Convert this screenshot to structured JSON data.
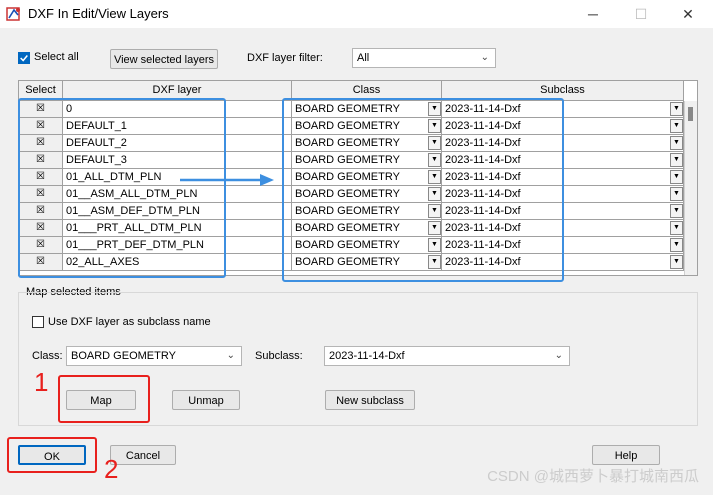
{
  "window": {
    "title": "DXF In Edit/View Layers",
    "minimize": "─",
    "maximize": "☐",
    "close": "✕"
  },
  "toolbar": {
    "select_all_label": "Select all",
    "view_selected_label": "View selected layers",
    "filter_label": "DXF layer filter:",
    "filter_value": "All"
  },
  "grid": {
    "headers": [
      "Select",
      "DXF layer",
      "Class",
      "Subclass"
    ],
    "rows": [
      {
        "selected": "☒",
        "layer": "0",
        "class": "BOARD GEOMETRY",
        "subclass": "2023-11-14-Dxf"
      },
      {
        "selected": "☒",
        "layer": "DEFAULT_1",
        "class": "BOARD GEOMETRY",
        "subclass": "2023-11-14-Dxf"
      },
      {
        "selected": "☒",
        "layer": "DEFAULT_2",
        "class": "BOARD GEOMETRY",
        "subclass": "2023-11-14-Dxf"
      },
      {
        "selected": "☒",
        "layer": "DEFAULT_3",
        "class": "BOARD GEOMETRY",
        "subclass": "2023-11-14-Dxf"
      },
      {
        "selected": "☒",
        "layer": "01_ALL_DTM_PLN",
        "class": "BOARD GEOMETRY",
        "subclass": "2023-11-14-Dxf"
      },
      {
        "selected": "☒",
        "layer": "01__ASM_ALL_DTM_PLN",
        "class": "BOARD GEOMETRY",
        "subclass": "2023-11-14-Dxf"
      },
      {
        "selected": "☒",
        "layer": "01__ASM_DEF_DTM_PLN",
        "class": "BOARD GEOMETRY",
        "subclass": "2023-11-14-Dxf"
      },
      {
        "selected": "☒",
        "layer": "01___PRT_ALL_DTM_PLN",
        "class": "BOARD GEOMETRY",
        "subclass": "2023-11-14-Dxf"
      },
      {
        "selected": "☒",
        "layer": "01___PRT_DEF_DTM_PLN",
        "class": "BOARD GEOMETRY",
        "subclass": "2023-11-14-Dxf"
      },
      {
        "selected": "☒",
        "layer": "02_ALL_AXES",
        "class": "BOARD GEOMETRY",
        "subclass": "2023-11-14-Dxf"
      }
    ]
  },
  "map_group": {
    "title": "Map selected items",
    "use_dxf_label": "Use DXF layer as subclass name",
    "class_label": "Class:",
    "class_value": "BOARD GEOMETRY",
    "subclass_label": "Subclass:",
    "subclass_value": "2023-11-14-Dxf",
    "map_label": "Map",
    "unmap_label": "Unmap",
    "new_subclass_label": "New subclass"
  },
  "footer": {
    "ok_label": "OK",
    "cancel_label": "Cancel",
    "help_label": "Help"
  },
  "annotations": {
    "num1": "1",
    "num2": "2",
    "watermark": "CSDN @城西萝卜暴打城南西瓜"
  },
  "colors": {
    "highlight_blue": "#3d8fe0",
    "highlight_red": "#e8201d",
    "checkbox_accent": "#0067c0"
  }
}
